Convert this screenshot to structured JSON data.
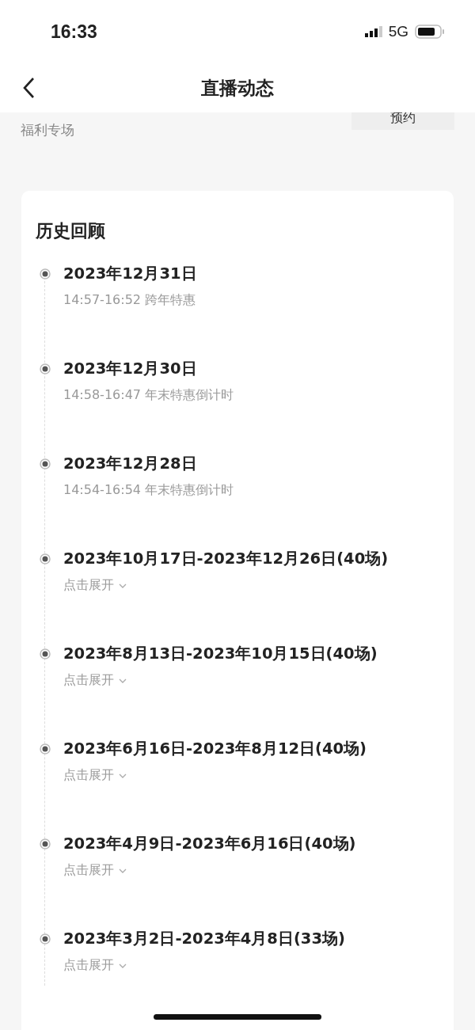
{
  "status_bar": {
    "time": "16:33",
    "network": "5G"
  },
  "nav": {
    "title": "直播动态"
  },
  "banner": {
    "label": "福利专场",
    "button": "预约"
  },
  "history": {
    "title": "历史回顾",
    "items": [
      {
        "kind": "session",
        "title": "2023年12月31日",
        "subtitle": "14:57-16:52 跨年特惠"
      },
      {
        "kind": "session",
        "title": "2023年12月30日",
        "subtitle": "14:58-16:47 年末特惠倒计时"
      },
      {
        "kind": "session",
        "title": "2023年12月28日",
        "subtitle": "14:54-16:54 年末特惠倒计时"
      },
      {
        "kind": "range",
        "title": "2023年10月17日-2023年12月26日(40场)",
        "toggle": "点击展开",
        "expanded": false
      },
      {
        "kind": "range",
        "title": "2023年8月13日-2023年10月15日(40场)",
        "toggle": "点击展开",
        "expanded": false
      },
      {
        "kind": "range",
        "title": "2023年6月16日-2023年8月12日(40场)",
        "toggle": "点击展开",
        "expanded": false
      },
      {
        "kind": "range",
        "title": "2023年4月9日-2023年6月16日(40场)",
        "toggle": "点击展开",
        "expanded": false
      },
      {
        "kind": "range",
        "title": "2023年3月2日-2023年4月8日(33场)",
        "toggle": "点击展开",
        "expanded": false
      }
    ]
  }
}
